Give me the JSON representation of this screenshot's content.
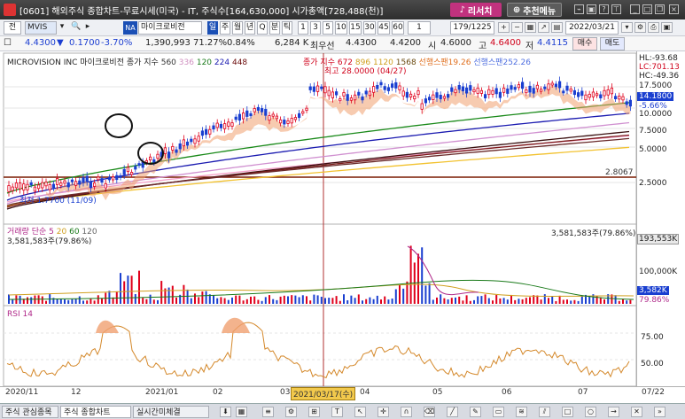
{
  "window": {
    "title": "[0601] 해외주식 종합차트-무료시세(미국) - IT, 주식수[164,630,000] 시가총액[728,488(천)]",
    "research_label": "리서치",
    "recommend_label": "추천메뉴"
  },
  "toolbar1": {
    "menu_label": "전",
    "symbol_value": "MVIS",
    "market_badge": "NA",
    "name_value": "마이크로비전",
    "periods": [
      "일",
      "주",
      "월",
      "년",
      "Q",
      "분",
      "틱"
    ],
    "intervals": [
      "1",
      "3",
      "5",
      "10",
      "15",
      "30",
      "45",
      "60"
    ],
    "count_value": "1",
    "range_value": "179/1225",
    "date_value": "2022/03/21"
  },
  "quote": {
    "price": "4.4300",
    "change_arrow": "▼",
    "change": "0.1700",
    "change_pct": "-3.70%",
    "volume": "1,390,993",
    "volume_ratio": "71.27%",
    "turnover": "0.84%",
    "amount": "6,284 K",
    "bid_label": "최우선",
    "bid": "4.4300",
    "ask": "4.4200",
    "open_label": "시",
    "open": "4.6000",
    "high_label": "고",
    "high": "4.6400",
    "low_label": "저",
    "low": "4.4115",
    "buy_label": "매수",
    "sell_label": "매도"
  },
  "price_panel": {
    "company": "MICROVISION INC",
    "name_kr": "마이크로비전",
    "ma_label": "종가 지수",
    "ma_periods": [
      "560",
      "336",
      "120",
      "224",
      "448"
    ],
    "ma2_label": "종가 지수",
    "ma2_periods": [
      "672",
      "896",
      "1120",
      "1568"
    ],
    "span1_label": "선행스팬1",
    "span1_value": "9.26",
    "span2_label": "선행스팬2",
    "span2_value": "52.26",
    "high_annotation": "최고 28.0000 (04/27)",
    "low_annotation": "최저 1.7700 (11/09)",
    "hline_value": "2.8067",
    "right_labels": {
      "hl": "HL:-93.68",
      "lc": "LC:701.13",
      "hc": "HC:-49.36",
      "p1": "17.5000",
      "cur": "14.1800",
      "pct": "-5.66%",
      "p2": "10.0000",
      "p3": "7.5000",
      "p4": "5.0000",
      "p5": "2.5000"
    }
  },
  "volume_panel": {
    "label": "거래량",
    "ma_label": "단순",
    "ma_periods": [
      "5",
      "20",
      "60",
      "120"
    ],
    "value_text": "3,581,583주(79.86%)",
    "right_labels": {
      "max": "193,553K",
      "mid": "100,000K",
      "cur": "3,582K",
      "pct": "79.86%"
    }
  },
  "rsi_panel": {
    "label": "RSI 14",
    "right_labels": {
      "l75": "75.00",
      "l50": "50.00"
    }
  },
  "date_axis": {
    "labels": [
      "2020/11",
      "12",
      "2021/01",
      "02",
      "03",
      "04",
      "05",
      "06",
      "07",
      "07/22"
    ],
    "cursor_date": "2021/03/17(수)"
  },
  "taskbar": {
    "items": [
      "주식 관심종목",
      "주식 종합차트",
      "실시간미체결"
    ]
  },
  "colors": {
    "candle_up": "#e0001b",
    "candle_down": "#1a3fd0",
    "cloud_up": "#f0a070",
    "cloud_down": "#7c96e8",
    "cursor": "#b03030",
    "hline": "#7a1a00",
    "rsi_line": "#d4882a"
  }
}
